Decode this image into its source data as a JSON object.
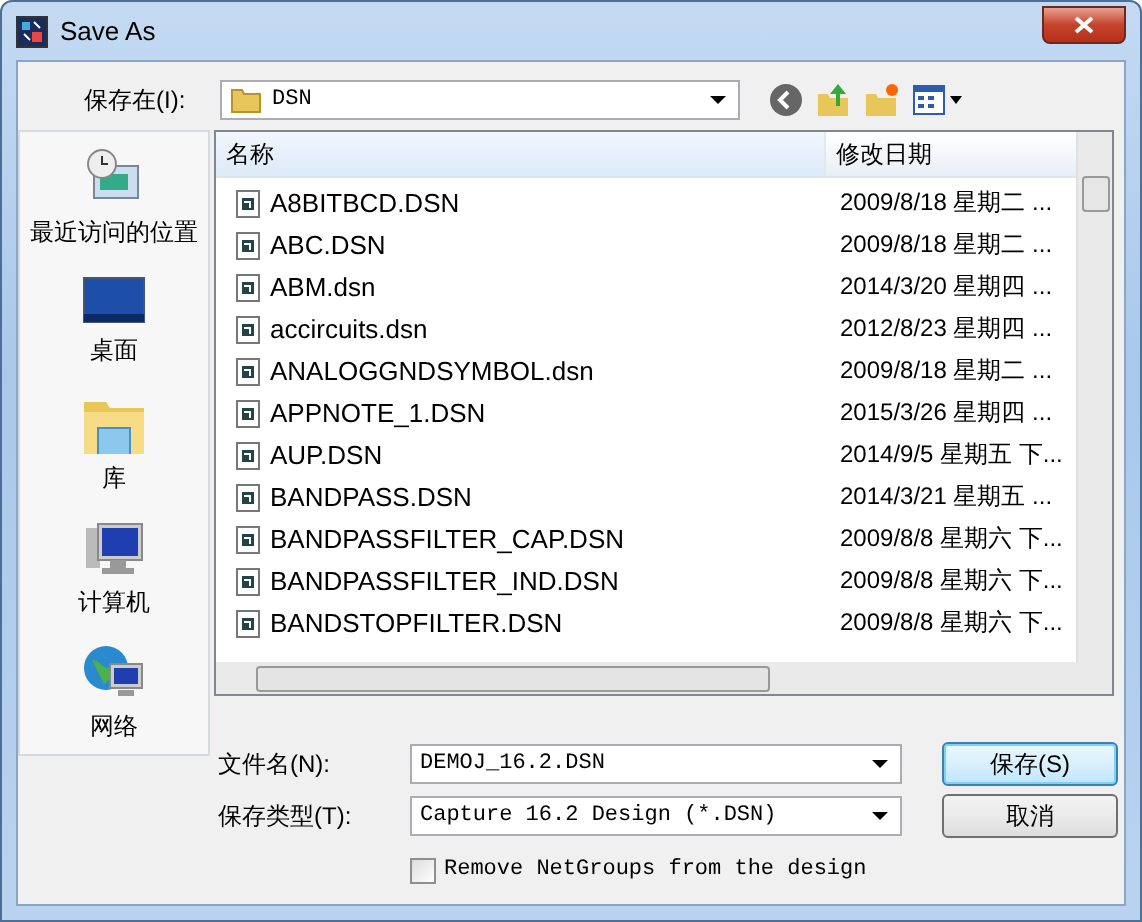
{
  "window": {
    "title": "Save As"
  },
  "save_in": {
    "label": "保存在(I):",
    "value": "DSN"
  },
  "places": [
    {
      "label": "最近访问的位置"
    },
    {
      "label": "桌面"
    },
    {
      "label": "库"
    },
    {
      "label": "计算机"
    },
    {
      "label": "网络"
    }
  ],
  "table": {
    "columns": [
      "名称",
      "修改日期"
    ],
    "rows": [
      {
        "name": "A8BITBCD.DSN",
        "modified": "2009/8/18 星期二 ..."
      },
      {
        "name": "ABC.DSN",
        "modified": "2009/8/18 星期二 ..."
      },
      {
        "name": "ABM.dsn",
        "modified": "2014/3/20 星期四 ..."
      },
      {
        "name": "accircuits.dsn",
        "modified": "2012/8/23 星期四 ..."
      },
      {
        "name": "ANALOGGNDSYMBOL.dsn",
        "modified": "2009/8/18 星期二 ..."
      },
      {
        "name": "APPNOTE_1.DSN",
        "modified": "2015/3/26 星期四 ..."
      },
      {
        "name": "AUP.DSN",
        "modified": "2014/9/5 星期五 下..."
      },
      {
        "name": "BANDPASS.DSN",
        "modified": "2014/3/21 星期五 ..."
      },
      {
        "name": "BANDPASSFILTER_CAP.DSN",
        "modified": "2009/8/8 星期六 下..."
      },
      {
        "name": "BANDPASSFILTER_IND.DSN",
        "modified": "2009/8/8 星期六 下..."
      },
      {
        "name": "BANDSTOPFILTER.DSN",
        "modified": "2009/8/8 星期六 下..."
      }
    ]
  },
  "file_name": {
    "label": "文件名(N):",
    "value": "DEMOJ_16.2.DSN"
  },
  "file_type": {
    "label": "保存类型(T):",
    "value": "Capture 16.2 Design (*.DSN)"
  },
  "remove_netgroups": {
    "label": "Remove NetGroups from the design",
    "checked": false
  },
  "buttons": [
    {
      "label": "保存(S)",
      "default": true
    },
    {
      "label": "取消",
      "default": false
    }
  ]
}
